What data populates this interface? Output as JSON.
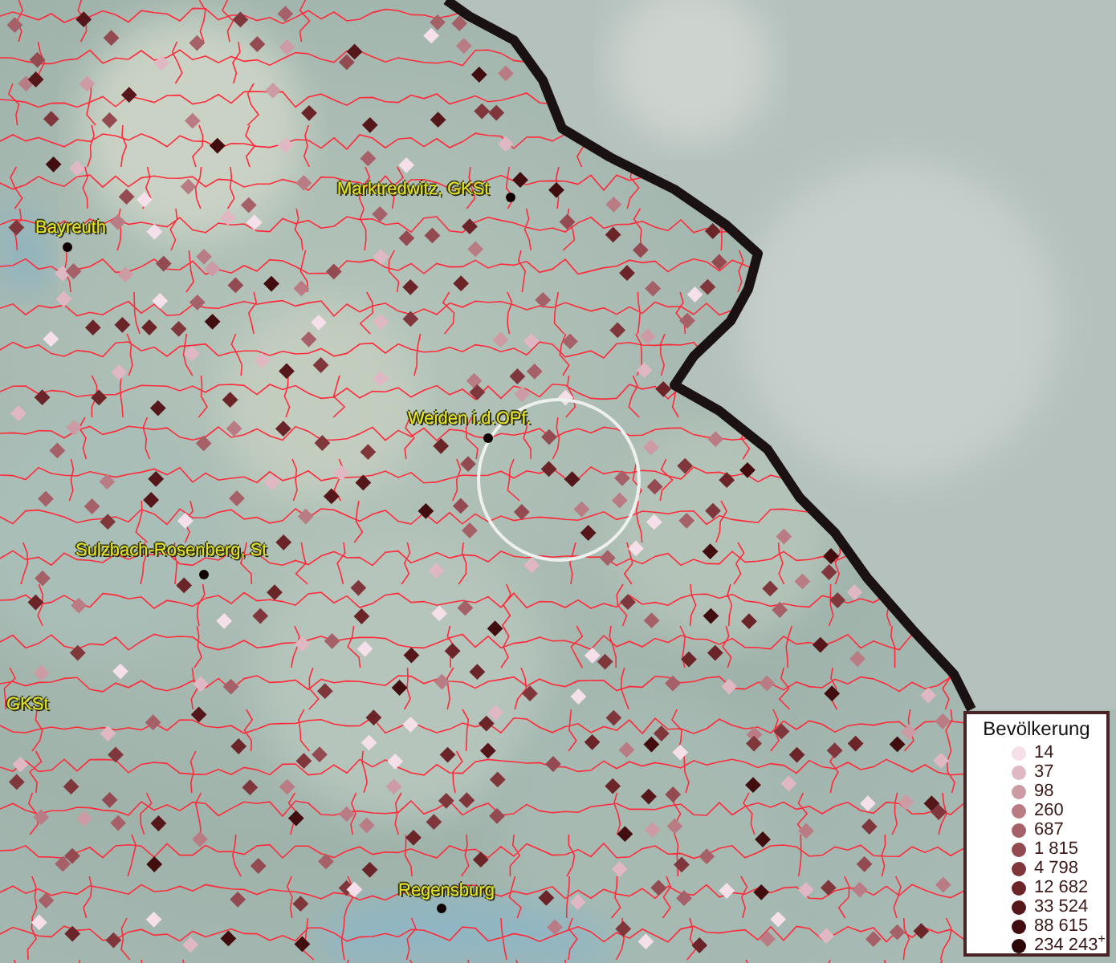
{
  "places": [
    {
      "label": "Marktredwitz, GKSt"
    },
    {
      "label": "Bayreuth"
    },
    {
      "label": "Weiden i.d.OPf."
    },
    {
      "label": "Sulzbach-Rosenberg, St"
    },
    {
      "label": "GKSt"
    },
    {
      "label": "Regensburg"
    }
  ],
  "legend": {
    "title": "Bevölkerung",
    "items": [
      {
        "label": "14",
        "color": "#f5e0ea"
      },
      {
        "label": "37",
        "color": "#e0b8c3"
      },
      {
        "label": "98",
        "color": "#cd9ba4"
      },
      {
        "label": "260",
        "color": "#ba7c84"
      },
      {
        "label": "687",
        "color": "#a66068"
      },
      {
        "label": "1 815",
        "color": "#934a50"
      },
      {
        "label": "4 798",
        "color": "#7f373c"
      },
      {
        "label": "12 682",
        "color": "#6b2529"
      },
      {
        "label": "33 524",
        "color": "#56171a"
      },
      {
        "label": "88 615",
        "color": "#420d0f"
      },
      {
        "label": "234 243$^{+}$",
        "color": "#2c0606"
      }
    ]
  }
}
